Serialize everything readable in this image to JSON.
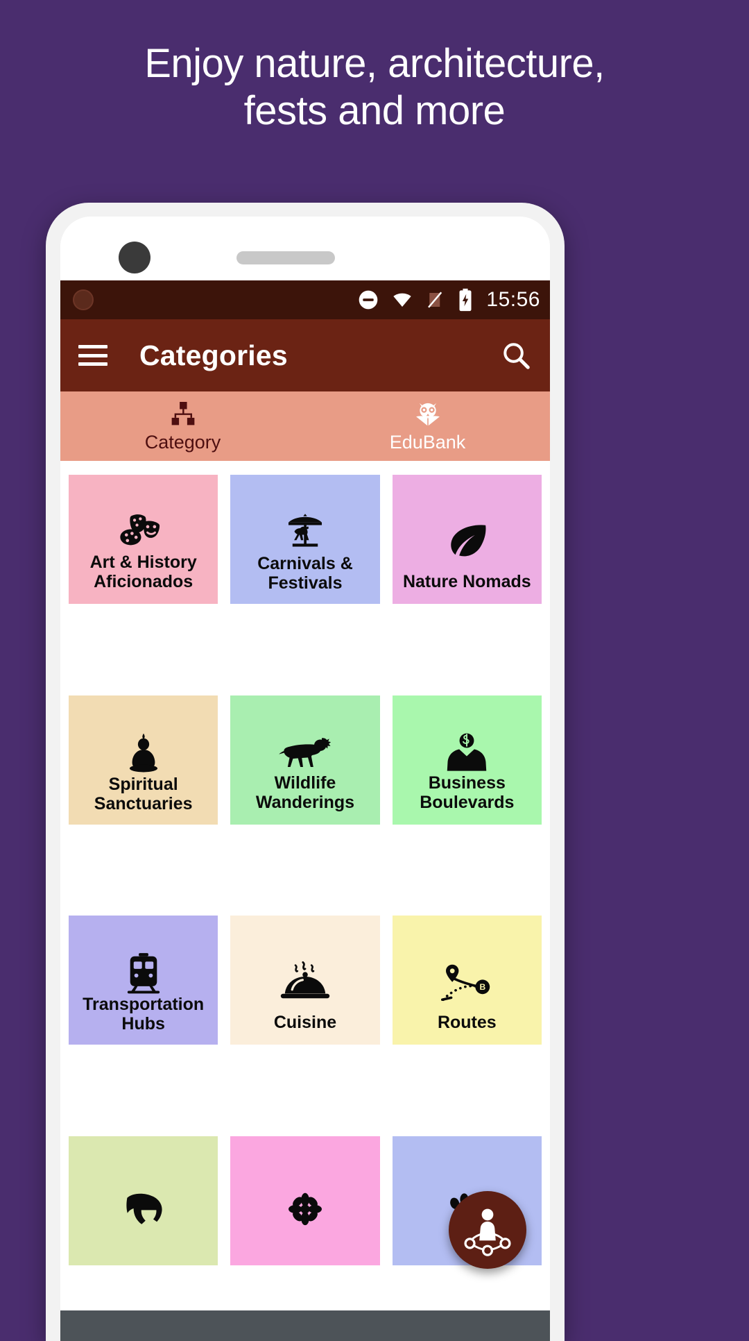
{
  "promo": {
    "headline_line1": "Enjoy nature, architecture,",
    "headline_line2": "fests and more",
    "background_color": "#4a2d6e",
    "text_color": "#ffffff"
  },
  "statusbar": {
    "time": "15:56",
    "background_color": "#3c140a",
    "icons": [
      "do-not-disturb-icon",
      "wifi-icon",
      "signal-off-icon",
      "battery-charging-icon"
    ]
  },
  "appbar": {
    "title": "Categories",
    "menu_icon": "hamburger-menu-icon",
    "search_icon": "search-icon",
    "background_color": "#6b2314"
  },
  "tabs": {
    "background_color": "#e89c86",
    "items": [
      {
        "label": "Category",
        "icon": "sitemap-icon",
        "selected": true
      },
      {
        "label": "EduBank",
        "icon": "owl-book-icon",
        "selected": false
      }
    ]
  },
  "grid": {
    "tiles": [
      {
        "label": "Art & History Aficionados",
        "icon": "theater-masks-palette-icon",
        "color": "#f7b3c2"
      },
      {
        "label": "Carnivals & Festivals",
        "icon": "carousel-icon",
        "color": "#b3bdf2"
      },
      {
        "label": "Nature Nomads",
        "icon": "leaf-icon",
        "color": "#edaee3"
      },
      {
        "label": "Spiritual Sanctuaries",
        "icon": "buddha-icon",
        "color": "#f2dcb3"
      },
      {
        "label": "Wildlife Wanderings",
        "icon": "lion-icon",
        "color": "#a9eeb0"
      },
      {
        "label": "Business Boulevards",
        "icon": "businessman-icon",
        "color": "#a9f7ad"
      },
      {
        "label": "Transportation Hubs",
        "icon": "train-icon",
        "color": "#b6b0ef"
      },
      {
        "label": "Cuisine",
        "icon": "food-cloche-icon",
        "color": "#fbeedb"
      },
      {
        "label": "Routes",
        "icon": "route-map-icon",
        "color": "#f9f3ab"
      },
      {
        "label": "",
        "icon": "spartan-helmet-icon",
        "color": "#dbe8b0"
      },
      {
        "label": "",
        "icon": "flower-icon",
        "color": "#fba7e0"
      },
      {
        "label": "",
        "icon": "paw-print-icon",
        "color": "#b3bdf2"
      }
    ]
  },
  "fab": {
    "icon": "traveler-network-icon",
    "background_color": "#5d1f14"
  }
}
